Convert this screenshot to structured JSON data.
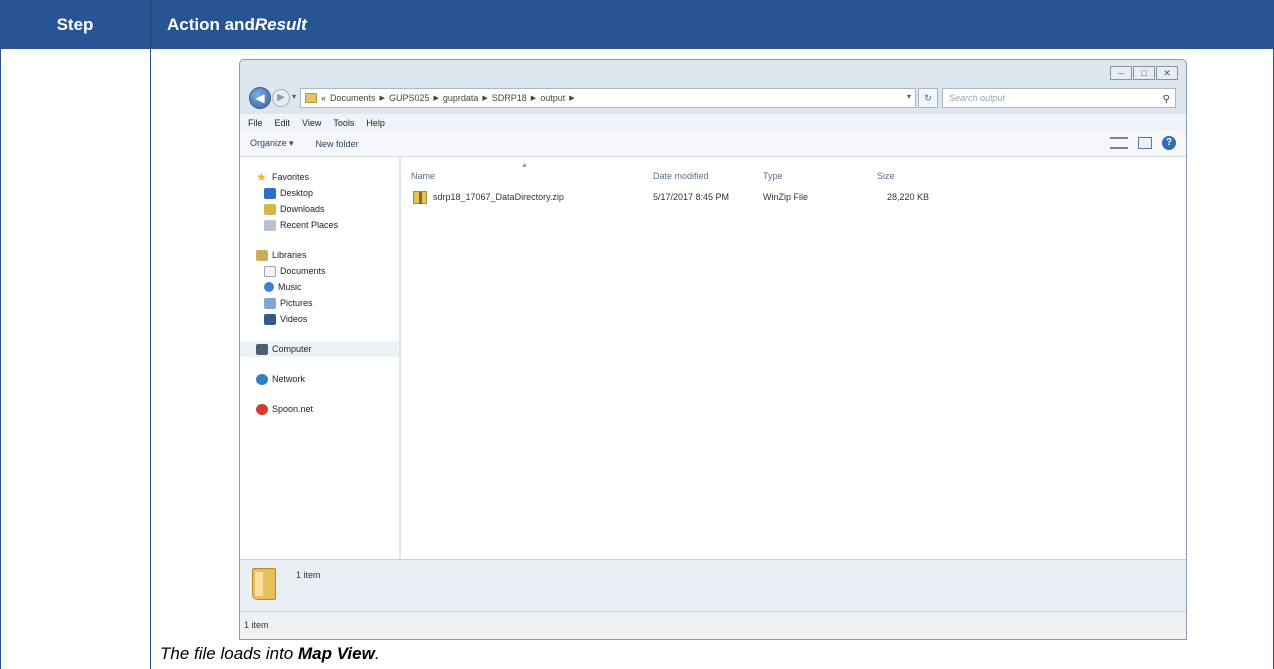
{
  "table": {
    "header_step": "Step",
    "header_action": "Action and ",
    "header_result": "Result"
  },
  "caption": {
    "prefix": "The file loads into ",
    "bold": "Map View",
    "suffix": "."
  },
  "explorer": {
    "window_controls": [
      "–",
      "□",
      "✕"
    ],
    "breadcrumbs": [
      "«",
      "Documents",
      "GUPS025",
      "guprdata",
      "SDRP18",
      "output"
    ],
    "search_placeholder": "Search output",
    "menu": [
      "File",
      "Edit",
      "View",
      "Tools",
      "Help"
    ],
    "toolbar": {
      "organize": "Organize ▾",
      "new_folder": "New folder"
    },
    "nav": {
      "favorites": "Favorites",
      "desktop": "Desktop",
      "downloads": "Downloads",
      "recent_places": "Recent Places",
      "libraries": "Libraries",
      "documents": "Documents",
      "music": "Music",
      "pictures": "Pictures",
      "videos": "Videos",
      "computer": "Computer",
      "network": "Network",
      "spoon": "Spoon.net"
    },
    "columns": {
      "name": "Name",
      "date": "Date modified",
      "type": "Type",
      "size": "Size"
    },
    "files": [
      {
        "name": "sdrp18_17067_DataDirectory.zip",
        "date": "5/17/2017 8:45 PM",
        "type": "WinZip File",
        "size": "28,220 KB"
      }
    ],
    "details_count": "1 item",
    "status_count": "1 item"
  }
}
